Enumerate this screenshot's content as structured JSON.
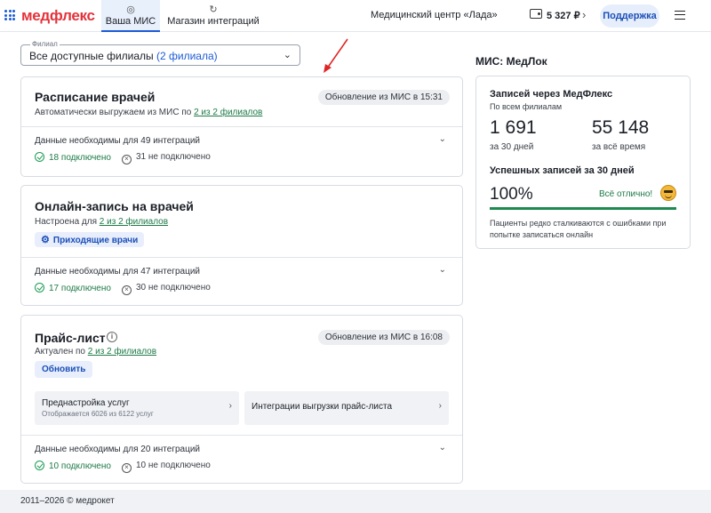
{
  "header": {
    "logo": "медфлекс",
    "tabs": [
      {
        "label": "Ваша МИС",
        "active": true,
        "icon": "target-icon"
      },
      {
        "label": "Магазин интеграций",
        "active": false,
        "icon": "refresh-icon"
      }
    ],
    "clinic": "Медицинский центр «Лада»",
    "balance": "5 327 ₽",
    "support": "Поддержка"
  },
  "branch": {
    "label": "Филиал",
    "value": "Все доступные филиалы",
    "count": "(2 филиала)"
  },
  "cards": [
    {
      "title": "Расписание врачей",
      "sub_prefix": "Автоматически выгружаем из МИС по",
      "sub_link": "2 из 2 филиалов",
      "badge": "Обновление из МИС в 15:31",
      "needed": "Данные необходимы для 49 интеграций",
      "connected": "18 подключено",
      "not_connected": "31 не подключено"
    },
    {
      "title": "Онлайн-запись на врачей",
      "sub_prefix": "Настроена для",
      "sub_link": "2 из 2 филиалов",
      "button": "Приходящие врачи",
      "needed": "Данные необходимы для 47 интеграций",
      "connected": "17 подключено",
      "not_connected": "30 не подключено"
    },
    {
      "title": "Прайс-лист",
      "sub_prefix": "Актуален по",
      "sub_link": "2 из 2 филиалов",
      "badge": "Обновление из МИС в 16:08",
      "button": "Обновить",
      "sub_cards": [
        {
          "title": "Преднастройка услуг",
          "subtitle": "Отображается 6026 из 6122 услуг"
        },
        {
          "title": "Интеграции выгрузки прайс-листа",
          "subtitle": ""
        }
      ],
      "needed": "Данные необходимы для 20 интеграций",
      "connected": "10 подключено",
      "not_connected": "10 не подключено"
    }
  ],
  "stats": {
    "mis_title": "МИС: МедЛок",
    "heading": "Записей через МедФлекс",
    "subheading": "По всем филиалам",
    "month_value": "1 691",
    "month_label": "за 30 дней",
    "total_value": "55 148",
    "total_label": "за всё время",
    "success_heading": "Успешных записей за 30 дней",
    "success_pct": "100%",
    "success_fraction": 1.0,
    "success_text": "Всё отлично!",
    "note": "Пациенты редко сталкиваются с ошибками при попытке записаться онлайн"
  },
  "footer": "2011–2026 © медрокет",
  "colors": {
    "accent": "#1d5bd6",
    "logo": "#e3323b",
    "success": "#1d7a47",
    "annotation_arrow": "#e02424"
  }
}
